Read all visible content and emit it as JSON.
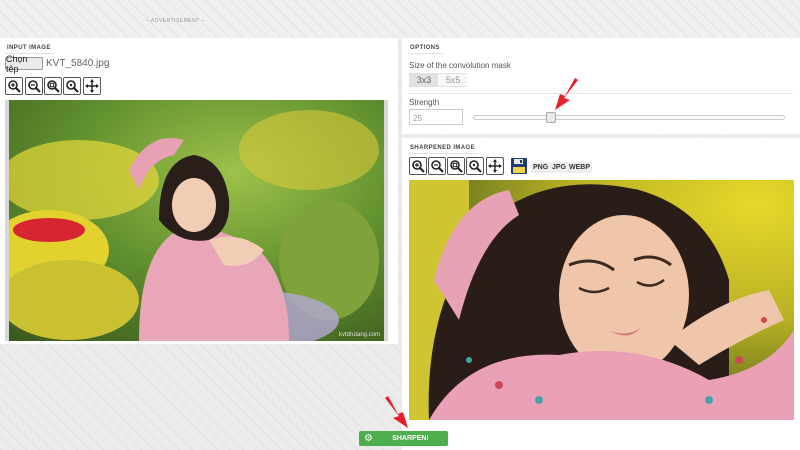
{
  "ad": {
    "label": "– ADVERTISEMENT –"
  },
  "input_panel": {
    "title": "INPUT IMAGE",
    "choose_button": "Chọn tệp",
    "file_name": "KVT_5840.jpg",
    "tools": [
      "zoom-in-icon",
      "zoom-out-icon",
      "zoom-fit-icon",
      "zoom-actual-icon",
      "move-icon"
    ],
    "watermark": "kvtdrutang.com"
  },
  "options_panel": {
    "title": "OPTIONS",
    "mask_label": "Size of the convolution mask",
    "mask_options": [
      "3x3",
      "5x5"
    ],
    "mask_selected": "3x3",
    "strength_label": "Strength",
    "strength_value": "25",
    "strength_fraction": 0.25
  },
  "output_panel": {
    "title": "SHARPENED IMAGE",
    "formats": [
      "PNG",
      "JPG",
      "WEBP"
    ]
  },
  "action": {
    "sharpen_label": "SHARPEN!"
  },
  "colors": {
    "accent_green": "#4cae4c",
    "arrow_red": "#e8202a"
  }
}
